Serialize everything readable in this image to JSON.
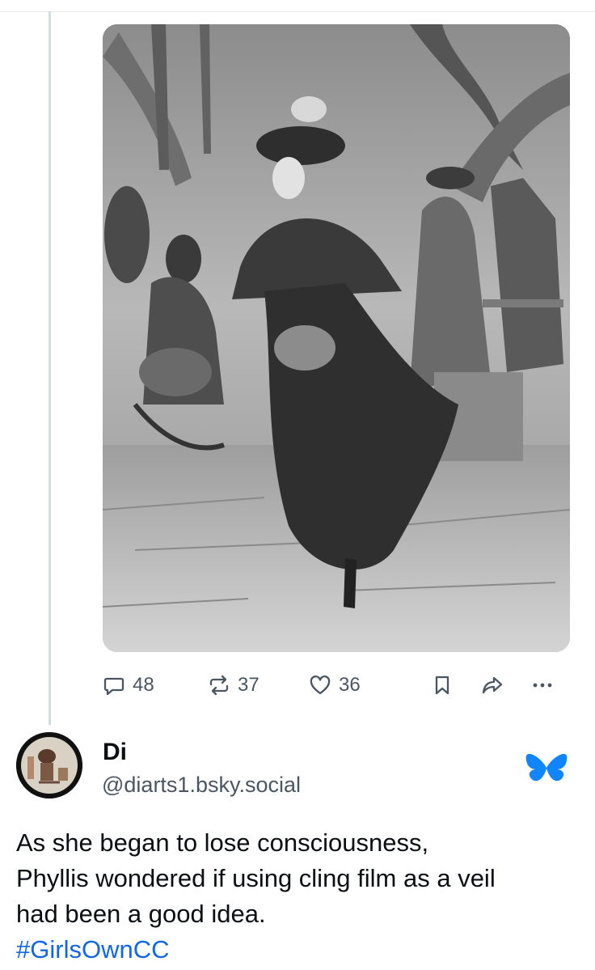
{
  "post": {
    "image_alt": "Vintage illustration of a woman ice skating in a long dark dress and fur-trimmed cape, with people seated at tea tables in the background",
    "actions": {
      "replies": "48",
      "reposts": "37",
      "likes": "36"
    }
  },
  "reply": {
    "display_name": "Di",
    "handle": "@diarts1.bsky.social",
    "text_lines": [
      "As she began to lose consciousness,",
      "Phyllis wondered if using cling film as a veil",
      "had been a good idea."
    ],
    "hashtag": "#GirlsOwnCC"
  },
  "icons": {
    "reply": "speech-bubble-icon",
    "repost": "repost-arrows-icon",
    "like": "heart-icon",
    "bookmark": "bookmark-icon",
    "share": "share-arrow-icon",
    "more": "ellipsis-icon",
    "platform": "butterfly-icon"
  },
  "colors": {
    "text": "#0b0f14",
    "muted": "#4a5663",
    "link": "#1268e3",
    "thread_line": "#d4dbe2",
    "brand": "#1185fe"
  }
}
